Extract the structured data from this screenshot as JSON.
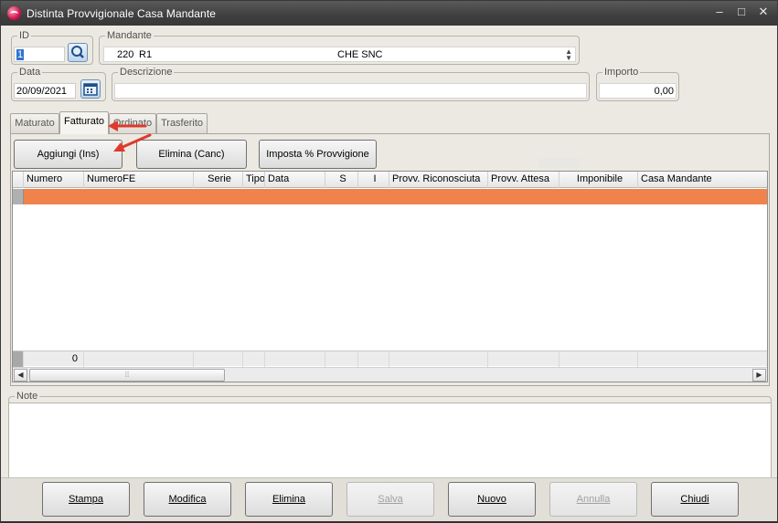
{
  "window": {
    "title": "Distinta Provvigionale Casa Mandante",
    "controls": [
      "–",
      "□",
      "✕"
    ]
  },
  "header": {
    "id_label": "ID",
    "id_value": "1",
    "mandante_label": "Mandante",
    "mandante_code": "220",
    "mandante_name_left": "R1",
    "mandante_name_right": "CHE SNC",
    "data_label": "Data",
    "data_value": "20/09/2021",
    "descrizione_label": "Descrizione",
    "descrizione_value": "",
    "importo_label": "Importo",
    "importo_value": "0,00"
  },
  "tabs": [
    {
      "label": "Maturato"
    },
    {
      "label": "Fatturato"
    },
    {
      "label": "Ordinato"
    },
    {
      "label": "Trasferito"
    }
  ],
  "actions": {
    "add": "Aggiungi (Ins)",
    "delete": "Elimina (Canc)",
    "set_percent": "Imposta % Provvigione"
  },
  "grid": {
    "columns": [
      "Numero",
      "NumeroFE",
      "Serie",
      "Tipo",
      "Data",
      "S",
      "I",
      "Provv. Riconosciuta",
      "Provv. Attesa",
      "Imponibile",
      "Casa Mandante"
    ],
    "footer_count": "0"
  },
  "note": {
    "label": "Note",
    "value": ""
  },
  "bottom_buttons": {
    "stampa": "Stampa",
    "modifica": "Modifica",
    "elimina": "Elimina",
    "salva": "Salva",
    "nuovo": "Nuovo",
    "annulla": "Annulla",
    "chiudi": "Chiudi"
  },
  "colors": {
    "selected_row": "#f0834b",
    "annotation_arrow": "#e0392b",
    "titlebar": "#3f3f3f"
  }
}
